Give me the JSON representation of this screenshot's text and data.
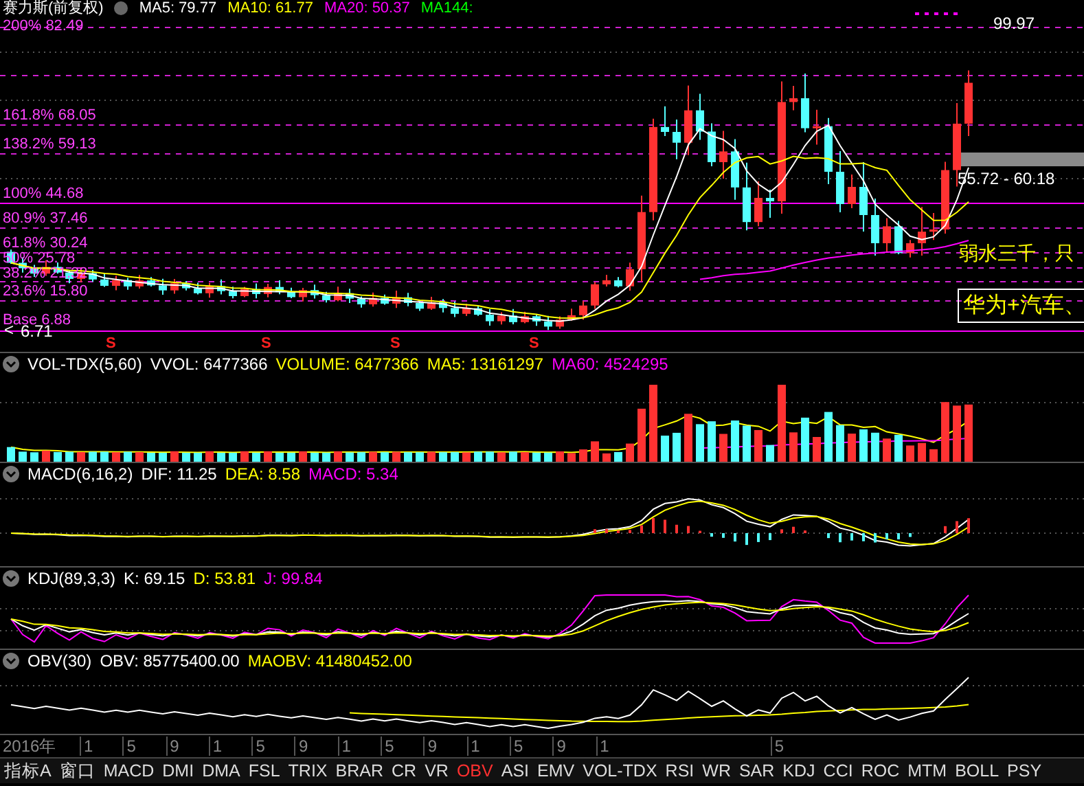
{
  "header": {
    "title": "赛力斯(前复权)",
    "indicators": [
      {
        "text": "MA5: 79.77",
        "color": "#ffffff"
      },
      {
        "text": "MA10: 61.77",
        "color": "#ffff00"
      },
      {
        "text": "MA20: 50.37",
        "color": "#ff00ff"
      },
      {
        "text": "MA144:",
        "color": "#00ff00"
      }
    ]
  },
  "fib_levels": [
    {
      "label": "200% 82.49",
      "kind": "dashed"
    },
    {
      "label": "161.8% 68.05",
      "kind": "dashed"
    },
    {
      "label": "138.2% 59.13",
      "kind": "dashed"
    },
    {
      "label": "100% 44.68",
      "kind": "solid"
    },
    {
      "label": "80.9% 37.46",
      "kind": "dashed"
    },
    {
      "label": "61.8% 30.24",
      "kind": "dashed"
    },
    {
      "label": "50% 25.78",
      "kind": "dashed"
    },
    {
      "label": "38.2% 21.32",
      "kind": "dashed"
    },
    {
      "label": "23.6% 15.80",
      "kind": "dashed"
    },
    {
      "label": "Base 6.88",
      "kind": "solid"
    }
  ],
  "price_marks": {
    "high": "99.97",
    "low": "6.71",
    "low_arrow": "<",
    "range": "55.72 - 60.18"
  },
  "notes": [
    {
      "text": "弱水三千，只",
      "kind": "plain"
    },
    {
      "text": "华为+汽车、",
      "kind": "boxed"
    }
  ],
  "sell_marks": [
    "S",
    "S",
    "S",
    "S"
  ],
  "panels": [
    {
      "kind": "volume",
      "name": "VOL-TDX(5,60)",
      "values": [
        {
          "text": "VVOL: 6477366",
          "color": "#ffffff"
        },
        {
          "text": "VOLUME: 6477366",
          "color": "#ffff00"
        },
        {
          "text": "MA5: 13161297",
          "color": "#ffff00"
        },
        {
          "text": "MA60: 4524295",
          "color": "#ff00ff"
        }
      ]
    },
    {
      "kind": "macd",
      "name": "MACD(6,16,2)",
      "values": [
        {
          "text": "DIF: 11.25",
          "color": "#ffffff"
        },
        {
          "text": "DEA: 8.58",
          "color": "#ffff00"
        },
        {
          "text": "MACD: 5.34",
          "color": "#ff00ff"
        }
      ]
    },
    {
      "kind": "kdj",
      "name": "KDJ(89,3,3)",
      "values": [
        {
          "text": "K: 69.15",
          "color": "#ffffff"
        },
        {
          "text": "D: 53.81",
          "color": "#ffff00"
        },
        {
          "text": "J: 99.84",
          "color": "#ff00ff"
        }
      ]
    },
    {
      "kind": "obv",
      "name": "OBV(30)",
      "values": [
        {
          "text": "OBV: 85775400.00",
          "color": "#ffffff"
        },
        {
          "text": "MAOBV: 41480452.00",
          "color": "#ffff00"
        }
      ]
    }
  ],
  "time_axis": {
    "year": "2016年",
    "ticks": [
      "1",
      "5",
      "9",
      "1",
      "5",
      "9",
      "1",
      "5",
      "9",
      "1",
      "5",
      "9",
      "1",
      "5"
    ]
  },
  "tabs": [
    {
      "label": "指标A",
      "selected": false
    },
    {
      "label": "窗口",
      "selected": false
    },
    {
      "label": "MACD",
      "selected": false
    },
    {
      "label": "DMI",
      "selected": false
    },
    {
      "label": "DMA",
      "selected": false
    },
    {
      "label": "FSL",
      "selected": false
    },
    {
      "label": "TRIX",
      "selected": false
    },
    {
      "label": "BRAR",
      "selected": false
    },
    {
      "label": "CR",
      "selected": false
    },
    {
      "label": "VR",
      "selected": false
    },
    {
      "label": "OBV",
      "selected": true
    },
    {
      "label": "ASI",
      "selected": false
    },
    {
      "label": "EMV",
      "selected": false
    },
    {
      "label": "VOL-TDX",
      "selected": false
    },
    {
      "label": "RSI",
      "selected": false
    },
    {
      "label": "WR",
      "selected": false
    },
    {
      "label": "SAR",
      "selected": false
    },
    {
      "label": "KDJ",
      "selected": false
    },
    {
      "label": "CCI",
      "selected": false
    },
    {
      "label": "ROC",
      "selected": false
    },
    {
      "label": "MTM",
      "selected": false
    },
    {
      "label": "BOLL",
      "selected": false
    },
    {
      "label": "PSY",
      "selected": false
    }
  ]
}
